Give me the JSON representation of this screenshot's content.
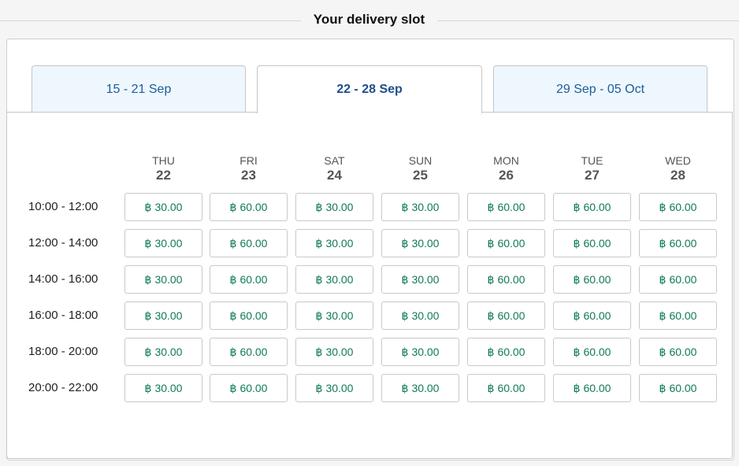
{
  "header": {
    "title": "Your delivery slot"
  },
  "tabs": [
    {
      "label": "15 - 21 Sep",
      "active": false
    },
    {
      "label": "22 - 28 Sep",
      "active": true
    },
    {
      "label": "29 Sep - 05 Oct",
      "active": false
    }
  ],
  "days": [
    {
      "name": "THU",
      "date": "22"
    },
    {
      "name": "FRI",
      "date": "23"
    },
    {
      "name": "SAT",
      "date": "24"
    },
    {
      "name": "SUN",
      "date": "25"
    },
    {
      "name": "MON",
      "date": "26"
    },
    {
      "name": "TUE",
      "date": "27"
    },
    {
      "name": "WED",
      "date": "28"
    }
  ],
  "currency_symbol": "฿",
  "time_slots": [
    {
      "label": "10:00 - 12:00",
      "prices": [
        "30.00",
        "60.00",
        "30.00",
        "30.00",
        "60.00",
        "60.00",
        "60.00"
      ]
    },
    {
      "label": "12:00 - 14:00",
      "prices": [
        "30.00",
        "60.00",
        "30.00",
        "30.00",
        "60.00",
        "60.00",
        "60.00"
      ]
    },
    {
      "label": "14:00 - 16:00",
      "prices": [
        "30.00",
        "60.00",
        "30.00",
        "30.00",
        "60.00",
        "60.00",
        "60.00"
      ]
    },
    {
      "label": "16:00 - 18:00",
      "prices": [
        "30.00",
        "60.00",
        "30.00",
        "30.00",
        "60.00",
        "60.00",
        "60.00"
      ]
    },
    {
      "label": "18:00 - 20:00",
      "prices": [
        "30.00",
        "60.00",
        "30.00",
        "30.00",
        "60.00",
        "60.00",
        "60.00"
      ]
    },
    {
      "label": "20:00 - 22:00",
      "prices": [
        "30.00",
        "60.00",
        "30.00",
        "30.00",
        "60.00",
        "60.00",
        "60.00"
      ]
    }
  ],
  "colors": {
    "price": "#0f7a56",
    "tab_text": "#1d5c9b",
    "tab_bg": "#eef7fe"
  }
}
